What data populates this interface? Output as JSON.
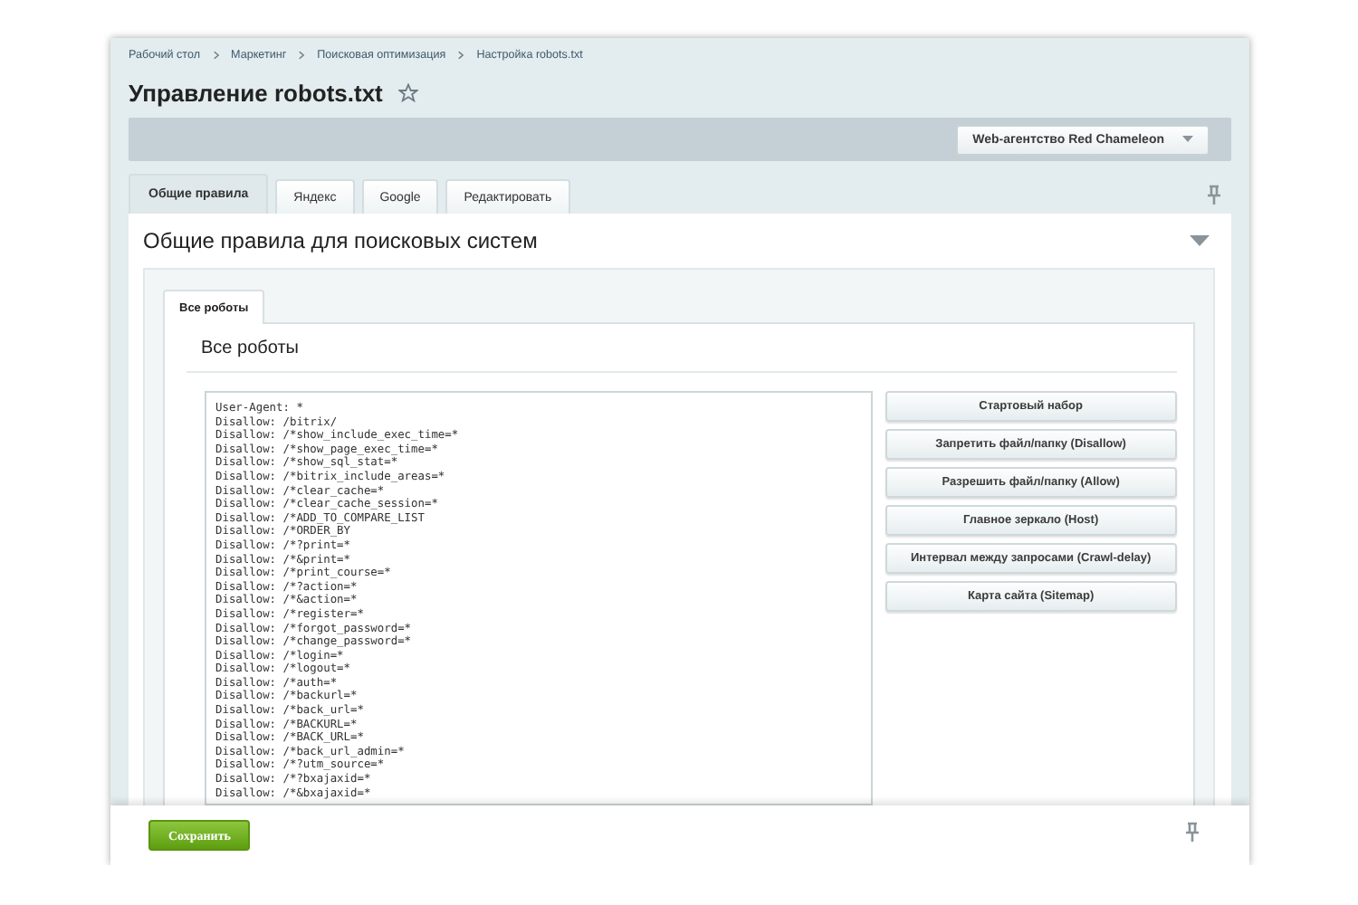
{
  "breadcrumbs": [
    "Рабочий стол",
    "Маркетинг",
    "Поисковая оптимизация",
    "Настройка robots.txt"
  ],
  "title": "Управление robots.txt",
  "favorite": false,
  "site_selector": {
    "label": "Web-агентство Red Chameleon"
  },
  "tabs": [
    {
      "label": "Общие правила",
      "selected": true
    },
    {
      "label": "Яндекс",
      "selected": false
    },
    {
      "label": "Google",
      "selected": false
    },
    {
      "label": "Редактировать",
      "selected": false
    }
  ],
  "section": {
    "title": "Общие правила для поисковых систем",
    "expanded": true,
    "inner_tabs": [
      {
        "label": "Все роботы",
        "selected": true
      }
    ],
    "heading": "Все роботы",
    "editor_lines": [
      "User-Agent: *",
      "Disallow: /bitrix/",
      "Disallow: /*show_include_exec_time=*",
      "Disallow: /*show_page_exec_time=*",
      "Disallow: /*show_sql_stat=*",
      "Disallow: /*bitrix_include_areas=*",
      "Disallow: /*clear_cache=*",
      "Disallow: /*clear_cache_session=*",
      "Disallow: /*ADD_TO_COMPARE_LIST",
      "Disallow: /*ORDER_BY",
      "Disallow: /*?print=*",
      "Disallow: /*&print=*",
      "Disallow: /*print_course=*",
      "Disallow: /*?action=*",
      "Disallow: /*&action=*",
      "Disallow: /*register=*",
      "Disallow: /*forgot_password=*",
      "Disallow: /*change_password=*",
      "Disallow: /*login=*",
      "Disallow: /*logout=*",
      "Disallow: /*auth=*",
      "Disallow: /*backurl=*",
      "Disallow: /*back_url=*",
      "Disallow: /*BACKURL=*",
      "Disallow: /*BACK_URL=*",
      "Disallow: /*back_url_admin=*",
      "Disallow: /*?utm_source=*",
      "Disallow: /*?bxajaxid=*",
      "Disallow: /*&bxajaxid=*"
    ],
    "actions": [
      "Стартовый набор",
      "Запретить файл/папку (Disallow)",
      "Разрешить файл/папку (Allow)",
      "Главное зеркало (Host)",
      "Интервал между запросами (Crawl-delay)",
      "Карта сайта (Sitemap)"
    ]
  },
  "save_button": "Сохранить"
}
